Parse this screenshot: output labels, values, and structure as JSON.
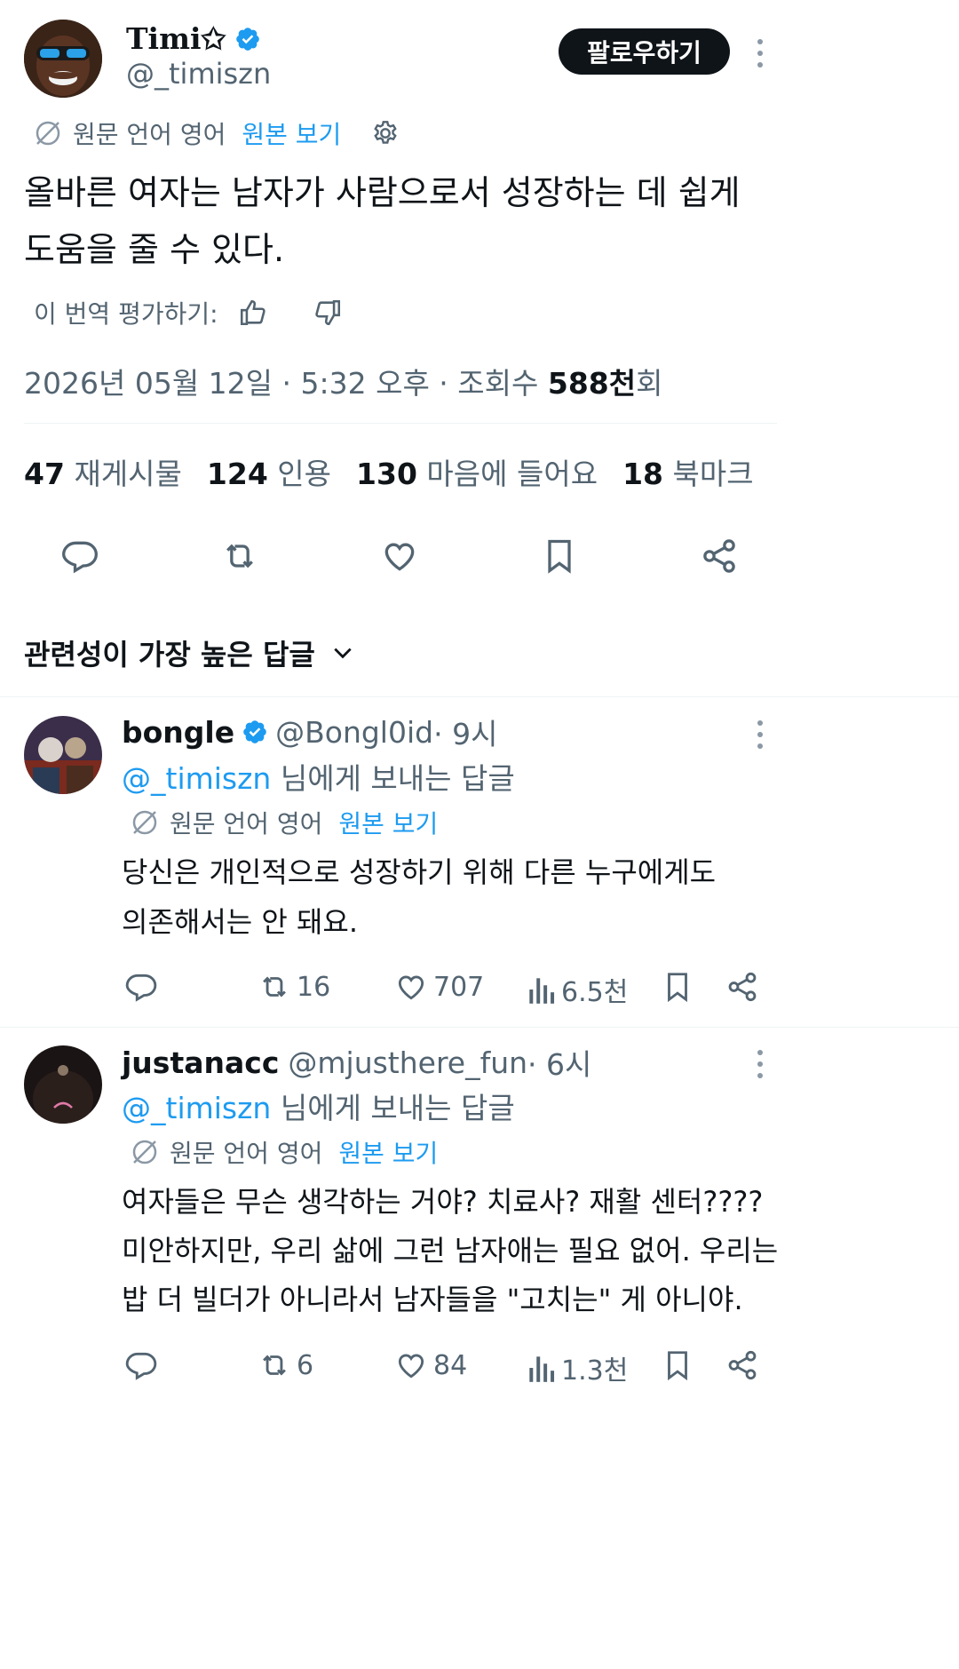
{
  "tweet": {
    "author_name": "Timi✩",
    "author_handle": "@_timiszn",
    "follow_label": "팔로우하기",
    "translation_note": "원문 언어 영어",
    "show_original": "원본 보기",
    "text_line1": "올바른 여자는 남자가 사람으로서 성장하는 데 쉽게",
    "text_line2": "도움을 줄 수 있다.",
    "rate_translation": "이 번역 평가하기:",
    "timestamp": "2026년 05월 12일 · 5:32 오후 · 조회수 ",
    "views_value": "588천",
    "views_suffix": "회"
  },
  "stats": [
    {
      "value": "47",
      "label": "재게시물"
    },
    {
      "value": "124",
      "label": "인용"
    },
    {
      "value": "130",
      "label": "마음에 들어요"
    },
    {
      "value": "18",
      "label": "북마크"
    }
  ],
  "replies_sort": {
    "label": "관련성이 가장 높은 답글"
  },
  "replies": [
    {
      "name": "bongle",
      "handle": "@Bongl0id",
      "time": " · 9시",
      "reply_to_handle": "@_timiszn",
      "reply_to_suffix": " 님에게 보내는 답글",
      "translation_note": "원문 언어 영어",
      "show_original": "원본 보기",
      "lines": [
        "당신은 개인적으로 성장하기 위해 다른 누구에게도",
        "의존해서는 안 돼요."
      ],
      "retweets": "16",
      "likes": "707",
      "views": "6.5천"
    },
    {
      "name": "justanacc",
      "handle": "@mjusthere_fun",
      "time": " · 6시",
      "reply_to_handle": "@_timiszn",
      "reply_to_suffix": " 님에게 보내는 답글",
      "translation_note": "원문 언어 영어",
      "show_original": "원본 보기",
      "lines": [
        "여자들은 무슨 생각하는 거야? 치료사? 재활 센터????",
        "미안하지만, 우리 삶에 그런 남자애는 필요 없어. 우리는",
        "밥 더 빌더가 아니라서 남자들을 \"고치는\" 게 아니야."
      ],
      "retweets": "6",
      "likes": "84",
      "views": "1.3천"
    }
  ],
  "colors": {
    "accent": "#1d9bf0",
    "text": "#0f1419",
    "secondary": "#536471",
    "divider": "#eff3f4"
  }
}
